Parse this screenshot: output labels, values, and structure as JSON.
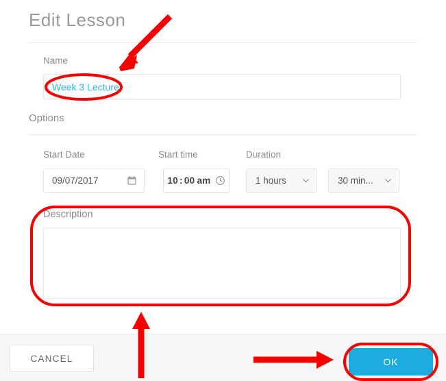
{
  "dialog": {
    "title": "Edit Lesson",
    "sections": {
      "options_label": "Options"
    },
    "name_field": {
      "label": "Name",
      "value": "Week 3 Lecture",
      "placeholder": "",
      "value_color": "#29b6e8"
    },
    "start_date": {
      "label": "Start Date",
      "value": "09/07/2017",
      "icon": "calendar-icon"
    },
    "start_time": {
      "label": "Start time",
      "hours": "10",
      "separator": ":",
      "minutes": "00",
      "meridiem": "am",
      "icon": "clock-icon"
    },
    "duration": {
      "label": "Duration",
      "hours_select": {
        "value": "1 hours",
        "icon": "chevron-down-icon"
      },
      "minutes_select": {
        "value": "30 min...",
        "icon": "chevron-down-icon"
      }
    },
    "description": {
      "label": "Description",
      "value": "",
      "placeholder": ""
    },
    "footer": {
      "cancel_label": "CANCEL",
      "ok_label": "OK",
      "ok_color": "#1cabdf"
    }
  },
  "annotations": {
    "color": "#f80000",
    "items": [
      {
        "name": "arrow-to-name-field",
        "type": "arrow",
        "direction": "down-left"
      },
      {
        "name": "ellipse-name-value",
        "type": "ellipse"
      },
      {
        "name": "ellipse-description-block",
        "type": "rounded-rect"
      },
      {
        "name": "arrow-to-description",
        "type": "arrow",
        "direction": "up"
      },
      {
        "name": "arrow-to-ok-button",
        "type": "arrow",
        "direction": "right"
      },
      {
        "name": "ellipse-ok-button",
        "type": "rounded-rect"
      }
    ]
  }
}
